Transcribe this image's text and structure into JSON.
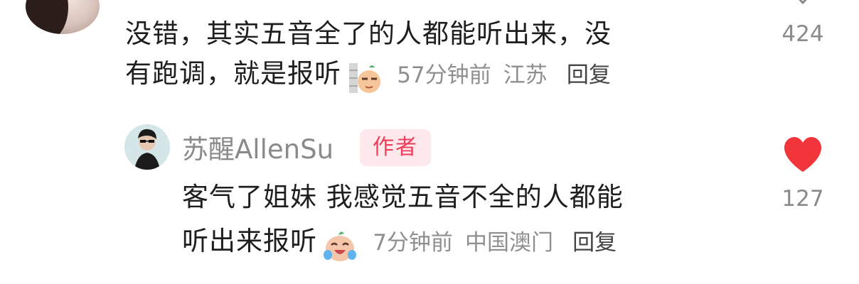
{
  "comment1": {
    "line1": "没错，其实五音全了的人都能听出来，没",
    "line2": "有跑调，就是报听",
    "emoji": "wall-peek-sticker",
    "time": "57分钟前",
    "location": "江苏",
    "reply_label": "回复",
    "like_count": "424",
    "like_icon": "heart-outline-icon"
  },
  "comment2": {
    "username": "苏醒AllenSu",
    "badge": "作者",
    "line1": "客气了姐妹 我感觉五音不全的人都能",
    "line2": "听出来报听",
    "emoji": "laughing-crying-sticker",
    "time": "7分钟前",
    "location": "中国澳门",
    "reply_label": "回复",
    "like_count": "127",
    "like_icon": "heart-filled-icon",
    "like_color": "#f2353b"
  },
  "colors": {
    "text": "#1e1e1e",
    "meta": "#8f8f8f",
    "badge_bg": "#fde9ec",
    "badge_text": "#f03c5a"
  }
}
